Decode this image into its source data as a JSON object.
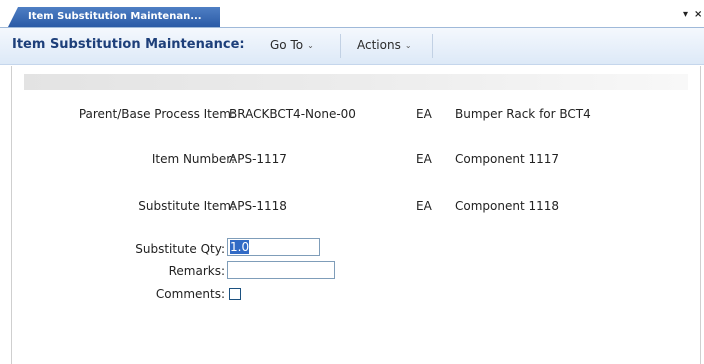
{
  "tab": {
    "label": "Item Substitution Maintenan..."
  },
  "window_controls": {
    "menu_glyph": "▾",
    "close_glyph": "×"
  },
  "toolbar": {
    "title": "Item Substitution Maintenance:",
    "goto_label": "Go To",
    "actions_label": "Actions",
    "chevron": "⌄"
  },
  "form": {
    "parent_item": {
      "label": "Parent/Base Process Item:",
      "value": "BRACKBCT4-None-00",
      "uom": "EA",
      "description": "Bumper Rack for BCT4"
    },
    "item_number": {
      "label": "Item Number:",
      "value": "APS-1117",
      "uom": "EA",
      "description": "Component 1117"
    },
    "substitute_item": {
      "label": "Substitute Item:",
      "value": "APS-1118",
      "uom": "EA",
      "description": "Component 1118"
    },
    "substitute_qty": {
      "label": "Substitute Qty:",
      "value": "1.0"
    },
    "remarks": {
      "label": "Remarks:",
      "value": ""
    },
    "comments": {
      "label": "Comments:",
      "checked": false
    }
  }
}
